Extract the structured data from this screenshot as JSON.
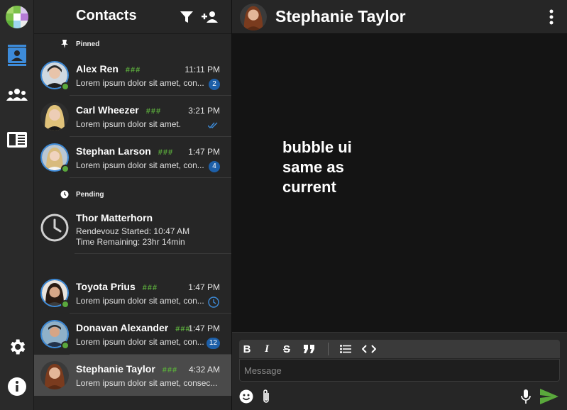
{
  "contacts": {
    "title": "Contacts",
    "sections": {
      "pinned_label": "Pinned",
      "pending_label": "Pending"
    },
    "pinned": [
      {
        "name": "Alex Ren",
        "tag": "###",
        "time": "11:11 PM",
        "preview": "Lorem ipsum dolor sit amet, con...",
        "badge": "2"
      },
      {
        "name": "Carl Wheezer",
        "tag": "###",
        "time": "3:21 PM",
        "preview": "Lorem ipsum dolor sit amet.",
        "status": "read-checkmarks"
      },
      {
        "name": "Stephan Larson",
        "tag": "###",
        "time": "1:47 PM",
        "preview": "Lorem ipsum dolor sit amet, con...",
        "badge": "4"
      }
    ],
    "pending": {
      "name": "Thor Matterhorn",
      "started": "Rendevouz Started: 10:47 AM",
      "remaining": "Time Remaining: 23hr 14min"
    },
    "others": [
      {
        "name": "Toyota Prius",
        "tag": "###",
        "time": "1:47 PM",
        "preview": "Lorem ipsum dolor sit amet, con...",
        "status": "clock"
      },
      {
        "name": "Donavan Alexander",
        "tag": "###",
        "time": "1:47 PM",
        "preview": "Lorem ipsum dolor sit amet, con...",
        "badge": "12"
      },
      {
        "name": "Stephanie Taylor",
        "tag": "###",
        "time": "4:32 AM",
        "preview": "Lorem ipsum dolor sit amet, consec..."
      }
    ]
  },
  "chat": {
    "title": "Stephanie Taylor",
    "note_line1": "bubble ui",
    "note_line2": "same as",
    "note_line3": "current",
    "composer": {
      "placeholder": "Message",
      "bold": "B",
      "italic": "I",
      "strike": "S"
    }
  },
  "colors": {
    "accent_blue": "#1d5fa8",
    "ring_blue": "#3d8bd9",
    "online_green": "#5aa83c",
    "send_green": "#5aa83c"
  },
  "icons": [
    "contacts-icon",
    "groups-icon",
    "newspaper-icon",
    "settings-icon",
    "info-icon",
    "filter-icon",
    "add-person-icon",
    "pin-icon",
    "clock-icon",
    "more-vert-icon",
    "emoji-icon",
    "attach-icon",
    "mic-icon",
    "send-icon"
  ]
}
